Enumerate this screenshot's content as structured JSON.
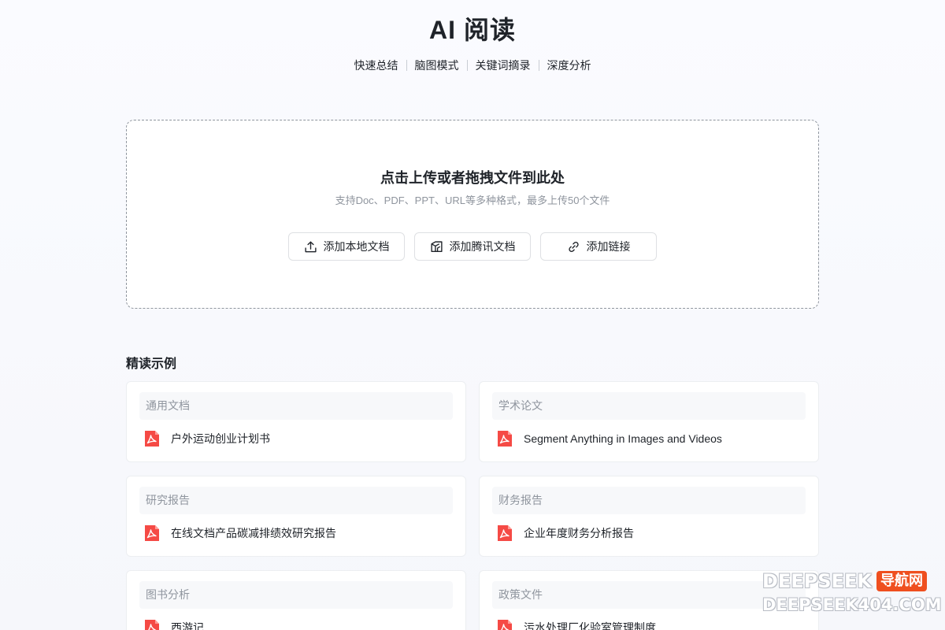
{
  "header": {
    "title": "AI 阅读",
    "features": [
      "快速总结",
      "脑图模式",
      "关键词摘录",
      "深度分析"
    ]
  },
  "upload": {
    "title": "点击上传或者拖拽文件到此处",
    "subtitle": "支持Doc、PDF、PPT、URL等多种格式，最多上传50个文件",
    "actions": [
      {
        "label": "添加本地文档",
        "icon": "upload-icon"
      },
      {
        "label": "添加腾讯文档",
        "icon": "tencent-docs-icon"
      },
      {
        "label": "添加链接",
        "icon": "link-icon"
      }
    ]
  },
  "examples": {
    "title": "精读示例",
    "cards": [
      {
        "category": "通用文档",
        "doc": "户外运动创业计划书"
      },
      {
        "category": "学术论文",
        "doc": "Segment Anything in Images and Videos"
      },
      {
        "category": "研究报告",
        "doc": "在线文档产品碳减排绩效研究报告"
      },
      {
        "category": "财务报告",
        "doc": "企业年度财务分析报告"
      },
      {
        "category": "图书分析",
        "doc": "西游记"
      },
      {
        "category": "政策文件",
        "doc": "污水处理厂化验室管理制度"
      }
    ]
  },
  "watermark": {
    "line1": "DEEPSEEK",
    "badge": "导航网",
    "line2": "DEEPSEEK404.COM"
  },
  "colors": {
    "accent_pdf": "#f54a45",
    "watermark_badge": "#ef4f1f"
  }
}
